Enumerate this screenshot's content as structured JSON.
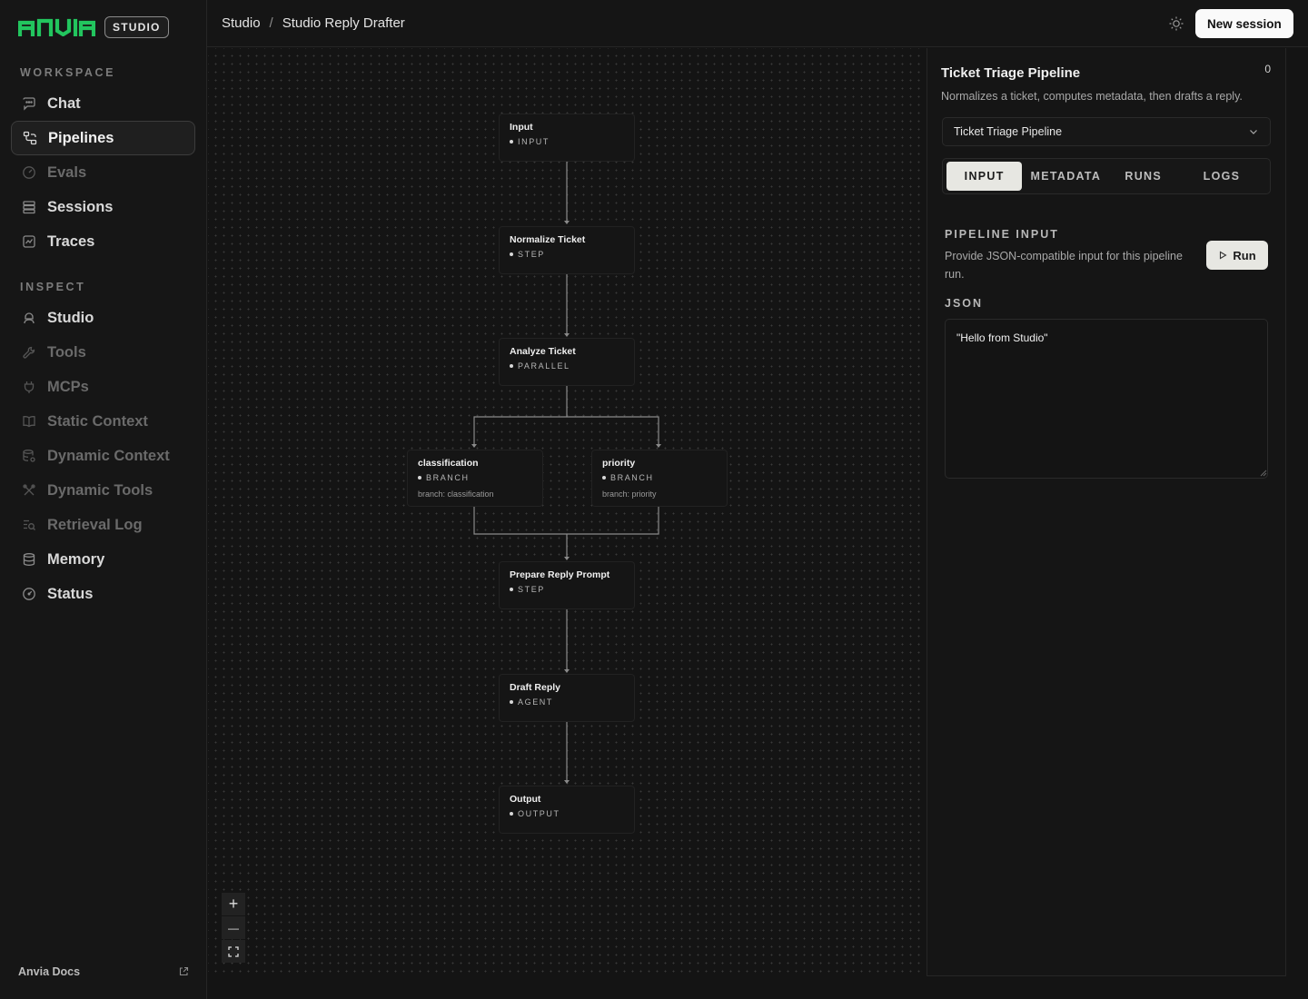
{
  "brand": {
    "logo_text": "ANVIA",
    "badge": "STUDIO",
    "accent_color": "#22c55e"
  },
  "sidebar": {
    "workspace_label": "WORKSPACE",
    "workspace_items": [
      {
        "label": "Chat",
        "icon": "chat-icon",
        "state": "normal"
      },
      {
        "label": "Pipelines",
        "icon": "pipelines-icon",
        "state": "active"
      },
      {
        "label": "Evals",
        "icon": "gauge-icon",
        "state": "dimmed"
      },
      {
        "label": "Sessions",
        "icon": "stack-icon",
        "state": "normal"
      },
      {
        "label": "Traces",
        "icon": "trace-icon",
        "state": "normal"
      }
    ],
    "inspect_label": "INSPECT",
    "inspect_items": [
      {
        "label": "Studio",
        "icon": "studio-icon",
        "state": "normal"
      },
      {
        "label": "Tools",
        "icon": "wrench-icon",
        "state": "dimmed"
      },
      {
        "label": "MCPs",
        "icon": "plug-icon",
        "state": "dimmed"
      },
      {
        "label": "Static Context",
        "icon": "book-icon",
        "state": "dimmed"
      },
      {
        "label": "Dynamic Context",
        "icon": "database-gear-icon",
        "state": "dimmed"
      },
      {
        "label": "Dynamic Tools",
        "icon": "tools-icon",
        "state": "dimmed"
      },
      {
        "label": "Retrieval Log",
        "icon": "search-list-icon",
        "state": "dimmed"
      },
      {
        "label": "Memory",
        "icon": "database-icon",
        "state": "normal"
      },
      {
        "label": "Status",
        "icon": "speedometer-icon",
        "state": "normal"
      }
    ],
    "docs_label": "Anvia Docs"
  },
  "header": {
    "breadcrumb_root": "Studio",
    "breadcrumb_sep": "/",
    "breadcrumb_current": "Studio Reply Drafter",
    "new_session_label": "New session"
  },
  "pipeline_graph": {
    "nodes": {
      "input": {
        "title": "Input",
        "kind": "INPUT"
      },
      "normalize": {
        "title": "Normalize Ticket",
        "kind": "STEP"
      },
      "analyze": {
        "title": "Analyze Ticket",
        "kind": "PARALLEL"
      },
      "classification": {
        "title": "classification",
        "kind": "BRANCH",
        "sub": "branch: classification"
      },
      "priority": {
        "title": "priority",
        "kind": "BRANCH",
        "sub": "branch: priority"
      },
      "prepare": {
        "title": "Prepare Reply Prompt",
        "kind": "STEP"
      },
      "draft": {
        "title": "Draft Reply",
        "kind": "AGENT"
      },
      "output": {
        "title": "Output",
        "kind": "OUTPUT"
      }
    },
    "zoom_controls": {
      "zoom_in": "+",
      "zoom_out": "—"
    }
  },
  "panel": {
    "title": "Ticket Triage Pipeline",
    "count": "0",
    "description": "Normalizes a ticket, computes metadata, then drafts a reply.",
    "selected_pipeline": "Ticket Triage Pipeline",
    "tabs": [
      "INPUT",
      "METADATA",
      "RUNS",
      "LOGS"
    ],
    "active_tab": "INPUT",
    "input_heading": "PIPELINE INPUT",
    "input_description": "Provide JSON-compatible input for this pipeline run.",
    "run_label": "Run",
    "json_label": "JSON",
    "json_value": "\"Hello from Studio\""
  }
}
